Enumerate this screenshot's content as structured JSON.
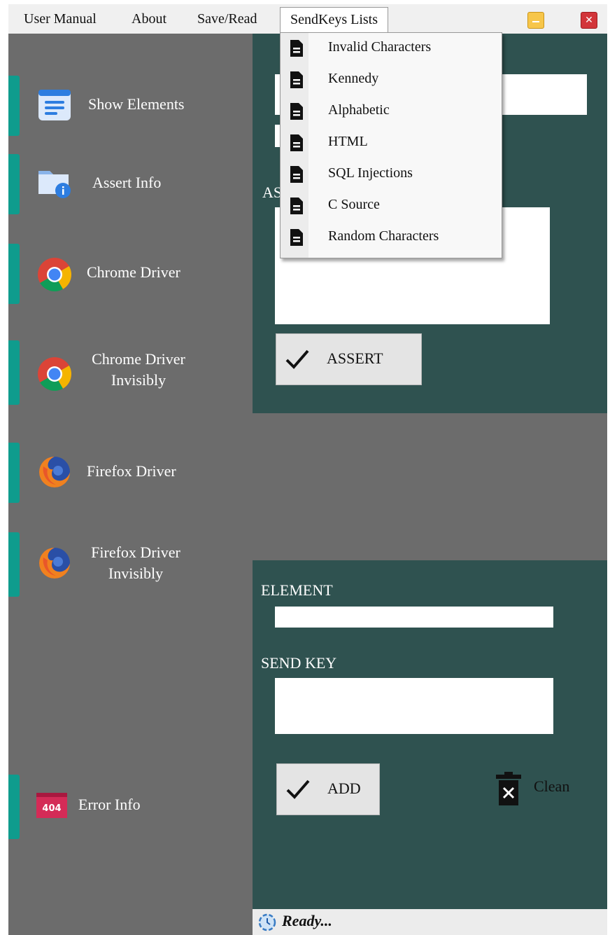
{
  "menubar": {
    "items": [
      "User Manual",
      "About",
      "Save/Read",
      "SendKeys Lists"
    ]
  },
  "sidebar": {
    "items": [
      {
        "label": "Show Elements",
        "icon": "document-list-icon"
      },
      {
        "label": "Assert Info",
        "icon": "folder-info-icon"
      },
      {
        "label": "Chrome Driver",
        "icon": "chrome-icon"
      },
      {
        "label_line1": "Chrome Driver",
        "label_line2": "Invisibly",
        "icon": "chrome-icon"
      },
      {
        "label": "Firefox Driver",
        "icon": "firefox-icon"
      },
      {
        "label_line1": "Firefox Driver",
        "label_line2": "Invisibly",
        "icon": "firefox-icon"
      },
      {
        "label": "Error Info",
        "icon": "error-404-icon",
        "icon_text": "404"
      }
    ]
  },
  "dropdown": {
    "items": [
      "Invalid Characters",
      "Kennedy",
      "Alphabetic",
      "HTML",
      "SQL Injections",
      "C Source",
      "Random Characters"
    ]
  },
  "assert_panel": {
    "assert_label_partial": "AS",
    "assert_button": "ASSERT"
  },
  "element_panel": {
    "element_label": "ELEMENT",
    "sendkey_label": "SEND KEY",
    "add_button": "ADD",
    "clean_label": "Clean"
  },
  "status": {
    "text": "Ready..."
  },
  "colors": {
    "accent": "#0f9c8d",
    "panel": "#2f5250",
    "sidebar": "#6c6c6c"
  }
}
